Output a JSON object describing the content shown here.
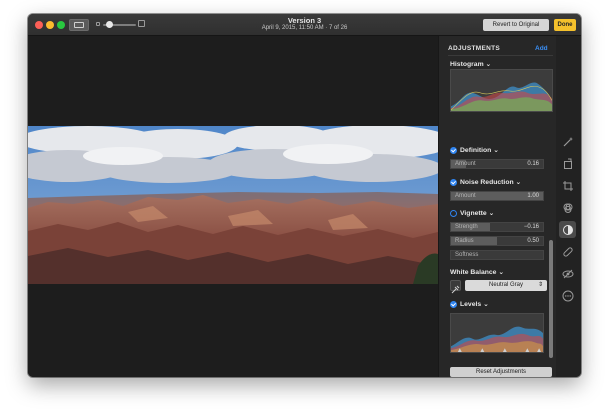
{
  "window": {
    "title": "Version 3",
    "subtitle": "April 9, 2015, 11:50 AM  ·  7 of 26",
    "revert_label": "Revert to Original",
    "done_label": "Done",
    "accent": "#3a8ff5",
    "done_color": "#f5c12c"
  },
  "zoom": {
    "level": 0.1
  },
  "panel": {
    "header": "ADJUSTMENTS",
    "add_label": "Add",
    "histogram_label": "Histogram",
    "definition": {
      "label": "Definition",
      "enabled": true,
      "amount_label": "Amount",
      "amount": "0.16",
      "amount_fraction": 0.16
    },
    "noise_reduction": {
      "label": "Noise Reduction",
      "enabled": true,
      "amount_label": "Amount",
      "amount": "1.00",
      "amount_fraction": 1.0
    },
    "vignette": {
      "label": "Vignette",
      "enabled": false,
      "strength_label": "Strength",
      "strength": "−0.16",
      "strength_fraction": 0.42,
      "radius_label": "Radius",
      "radius": "0.50",
      "radius_fraction": 0.5,
      "softness_label": "Softness"
    },
    "white_balance": {
      "label": "White Balance",
      "option": "Neutral Gray"
    },
    "levels": {
      "label": "Levels",
      "enabled": true
    },
    "reset_label": "Reset Adjustments"
  },
  "tools": [
    "magic-wand-icon",
    "rotate-icon",
    "crop-icon",
    "filters-icon",
    "adjust-icon",
    "retouch-icon",
    "red-eye-icon",
    "more-icon"
  ],
  "active_tool": "adjust-icon"
}
